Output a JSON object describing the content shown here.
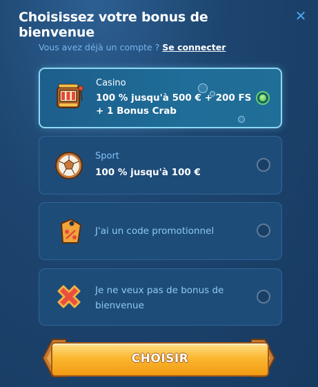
{
  "header": {
    "title": "Choisissez votre bonus de bienvenue",
    "close_icon": "close-icon"
  },
  "login": {
    "prompt": "Vous avez déjà un compte ?",
    "link": "Se connecter"
  },
  "options": [
    {
      "label": "Casino",
      "desc_line1": "100 % jusqu'à 500 € + 200 FS",
      "desc_line2": "+ 1 Bonus Crab",
      "icon": "slot-machine-icon",
      "selected": true
    },
    {
      "label": "Sport",
      "desc": "100 % jusqu'à 100 €",
      "icon": "soccer-ball-icon",
      "selected": false
    },
    {
      "text": "J'ai un code promotionnel",
      "icon": "percent-tag-icon",
      "selected": false
    },
    {
      "line1": "Je ne veux pas de bonus de",
      "line2": "bienvenue",
      "icon": "red-cross-icon",
      "selected": false
    }
  ],
  "action": {
    "label": "CHOISIR"
  },
  "colors": {
    "accent": "#4aa6ee",
    "selected_border": "#8fd9f5",
    "button": "#fbb730",
    "radio_on": "#5fd27a"
  }
}
